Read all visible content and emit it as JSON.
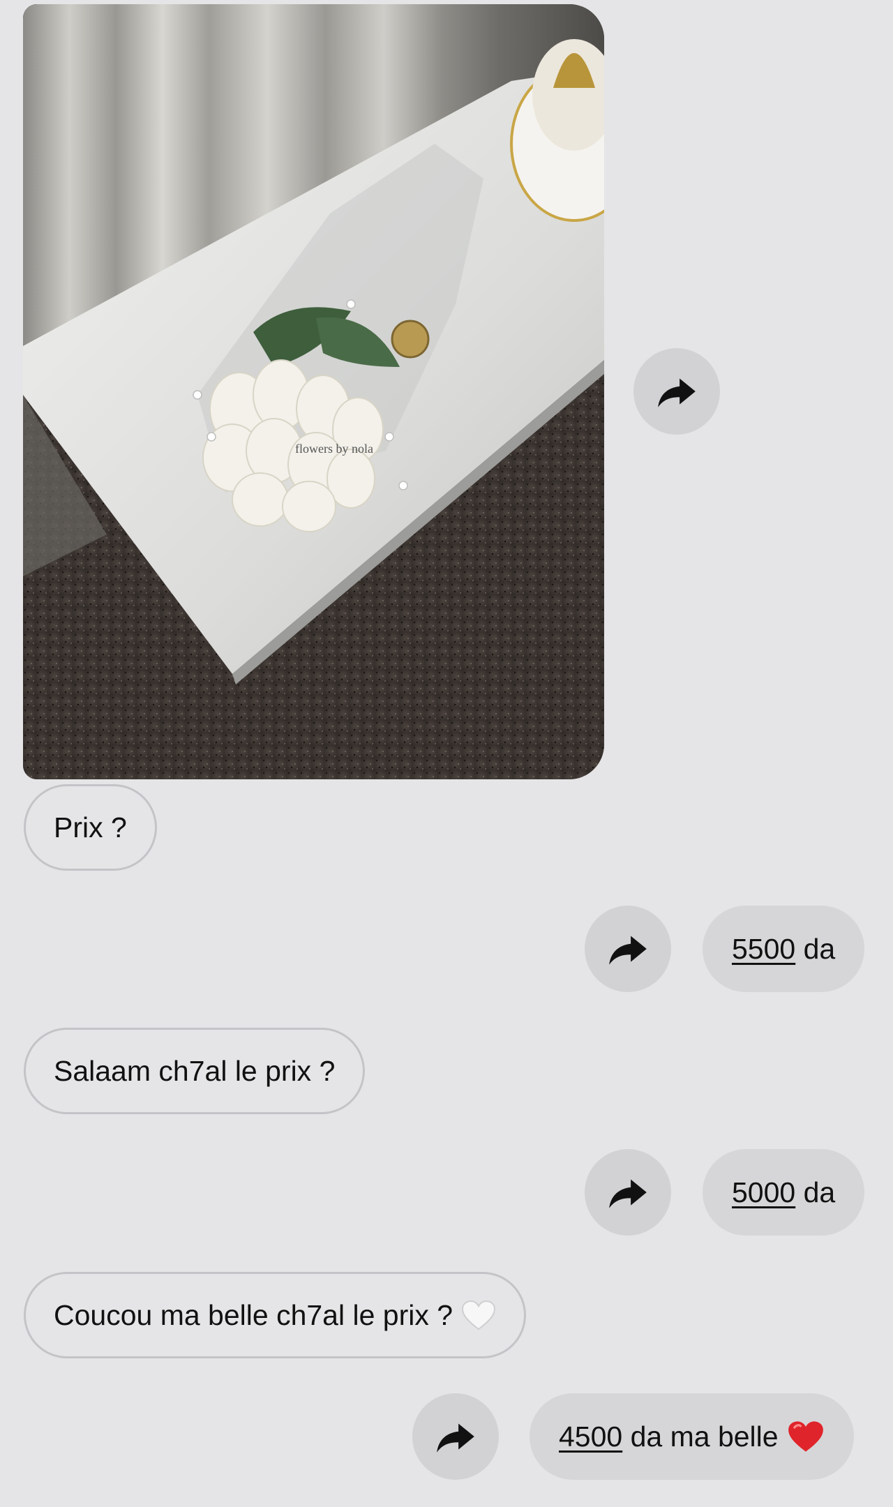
{
  "messages": {
    "photo": {
      "watermark": "flowers by nola",
      "icon": "image-attachment"
    },
    "m1": {
      "text": "Prix ?"
    },
    "r1": {
      "amount": "5500",
      "suffix": " da"
    },
    "m2": {
      "text": "Salaam ch7al le prix ?"
    },
    "r2": {
      "amount": "5000",
      "suffix": " da"
    },
    "m3": {
      "text": "Coucou ma belle ch7al le prix ?",
      "emoji": "white-heart"
    },
    "r3": {
      "amount": "4500",
      "suffix": " da ma belle",
      "emoji": "red-heart"
    }
  },
  "icons": {
    "forward": "share-forward-icon"
  },
  "colors": {
    "background": "#e5e5e7",
    "outgoing_bubble": "#d6d6d8",
    "incoming_border": "#c4c4c8",
    "forward_button": "#d2d2d5",
    "heart_red": "#e0242b"
  }
}
